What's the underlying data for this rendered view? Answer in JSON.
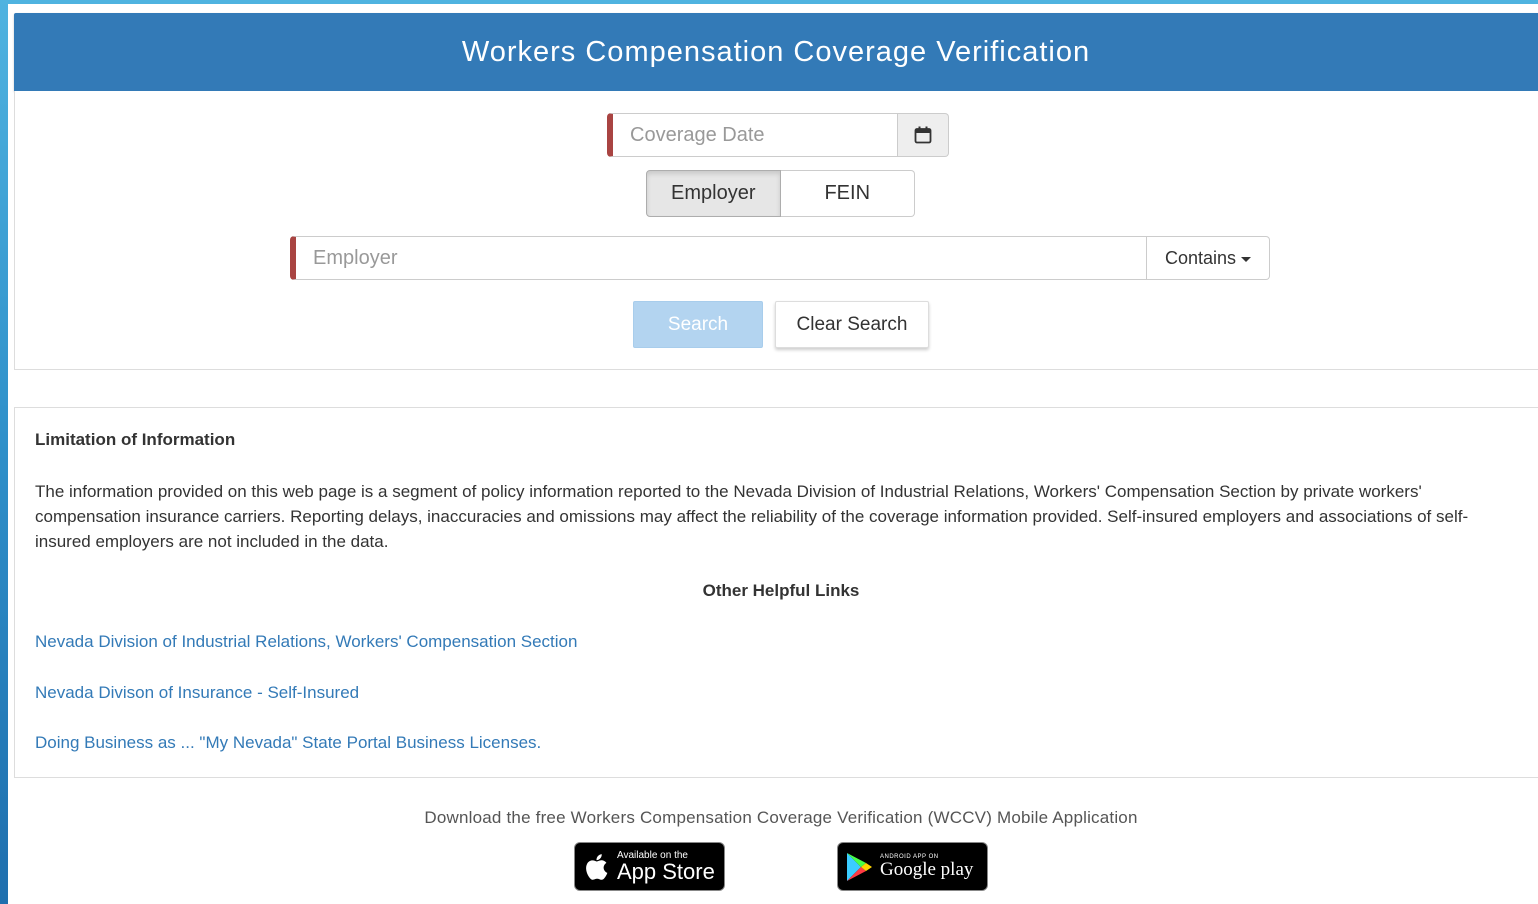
{
  "header": {
    "title": "Workers Compensation Coverage Verification"
  },
  "search": {
    "coverage_date_placeholder": "Coverage Date",
    "calendar_icon": "calendar-icon",
    "toggle": {
      "employer_label": "Employer",
      "fein_label": "FEIN",
      "selected": "Employer"
    },
    "employer_placeholder": "Employer",
    "match_mode": "Contains",
    "search_label": "Search",
    "clear_label": "Clear Search"
  },
  "info": {
    "title": "Limitation of Information",
    "body": "The information provided on this web page is a segment of policy information reported to the Nevada Division of Industrial Relations, Workers' Compensation Section by private workers' compensation insurance carriers. Reporting delays, inaccuracies and omissions may affect the reliability of the coverage information provided. Self-insured employers and associations of self-insured employers are not included in the data.",
    "links_title": "Other Helpful Links",
    "links": [
      {
        "label": "Nevada Division of Industrial Relations, Workers' Compensation Section"
      },
      {
        "label": "Nevada Divison of Insurance - Self-Insured"
      },
      {
        "label": "Doing Business as ... \"My Nevada\" State Portal Business Licenses."
      }
    ]
  },
  "footer": {
    "download_text": "Download the free Workers Compensation Coverage Verification (WCCV) Mobile Application",
    "app_store": {
      "small": "Available on the",
      "big": "App Store"
    },
    "google_play": {
      "small": "ANDROID APP ON",
      "big": "Google play"
    }
  },
  "colors": {
    "header_bg": "#337ab7",
    "required_marker": "#a94442",
    "link": "#337ab7",
    "search_disabled": "#b3d4f0"
  }
}
